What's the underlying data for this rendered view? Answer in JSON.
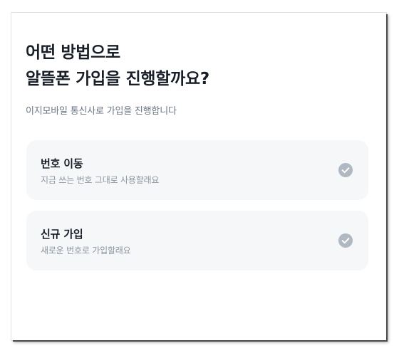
{
  "header": {
    "title_line1": "어떤 방법으로",
    "title_line2": "알뜰폰 가입을 진행할까요?",
    "subtitle": "이지모바일 통신사로 가입을 진행합니다"
  },
  "options": [
    {
      "title": "번호 이동",
      "description": "지금 쓰는 번호 그대로 사용할래요",
      "icon": "check-circle-icon"
    },
    {
      "title": "신규 가입",
      "description": "새로운 번호로 가입할래요",
      "icon": "check-circle-icon"
    }
  ],
  "colors": {
    "title": "#191f28",
    "subtitle": "#6b7684",
    "option_bg": "#f6f7f9",
    "check_icon": "#b0b8c1"
  }
}
